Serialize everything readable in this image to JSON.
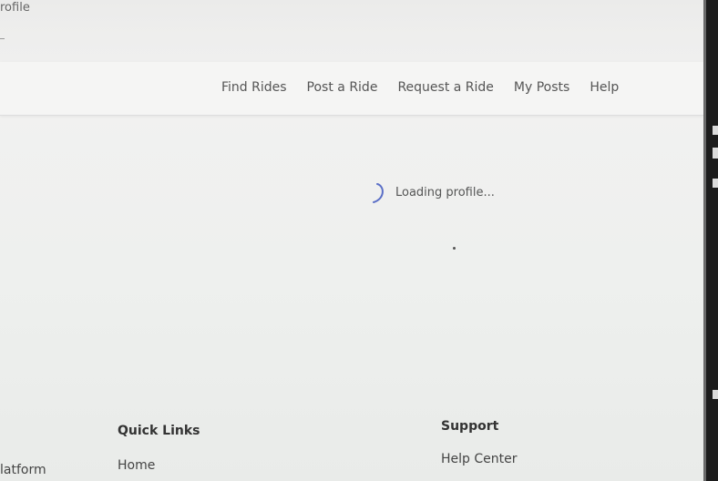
{
  "browser": {
    "tab_title": "rofile"
  },
  "navbar": {
    "links": [
      "Find Rides",
      "Post a Ride",
      "Request a Ride",
      "My Posts",
      "Help"
    ]
  },
  "main": {
    "loading_text": "Loading profile..."
  },
  "footer": {
    "brand_fragment": "latform",
    "quick_links": {
      "heading": "Quick Links",
      "items": [
        "Home"
      ]
    },
    "support": {
      "heading": "Support",
      "items": [
        "Help Center"
      ]
    }
  },
  "icons": {
    "spinner": "loading-spinner-icon"
  },
  "colors": {
    "spinner": "#5b6fc7",
    "text": "#555555",
    "navbar_bg": "#f5f5f4"
  }
}
